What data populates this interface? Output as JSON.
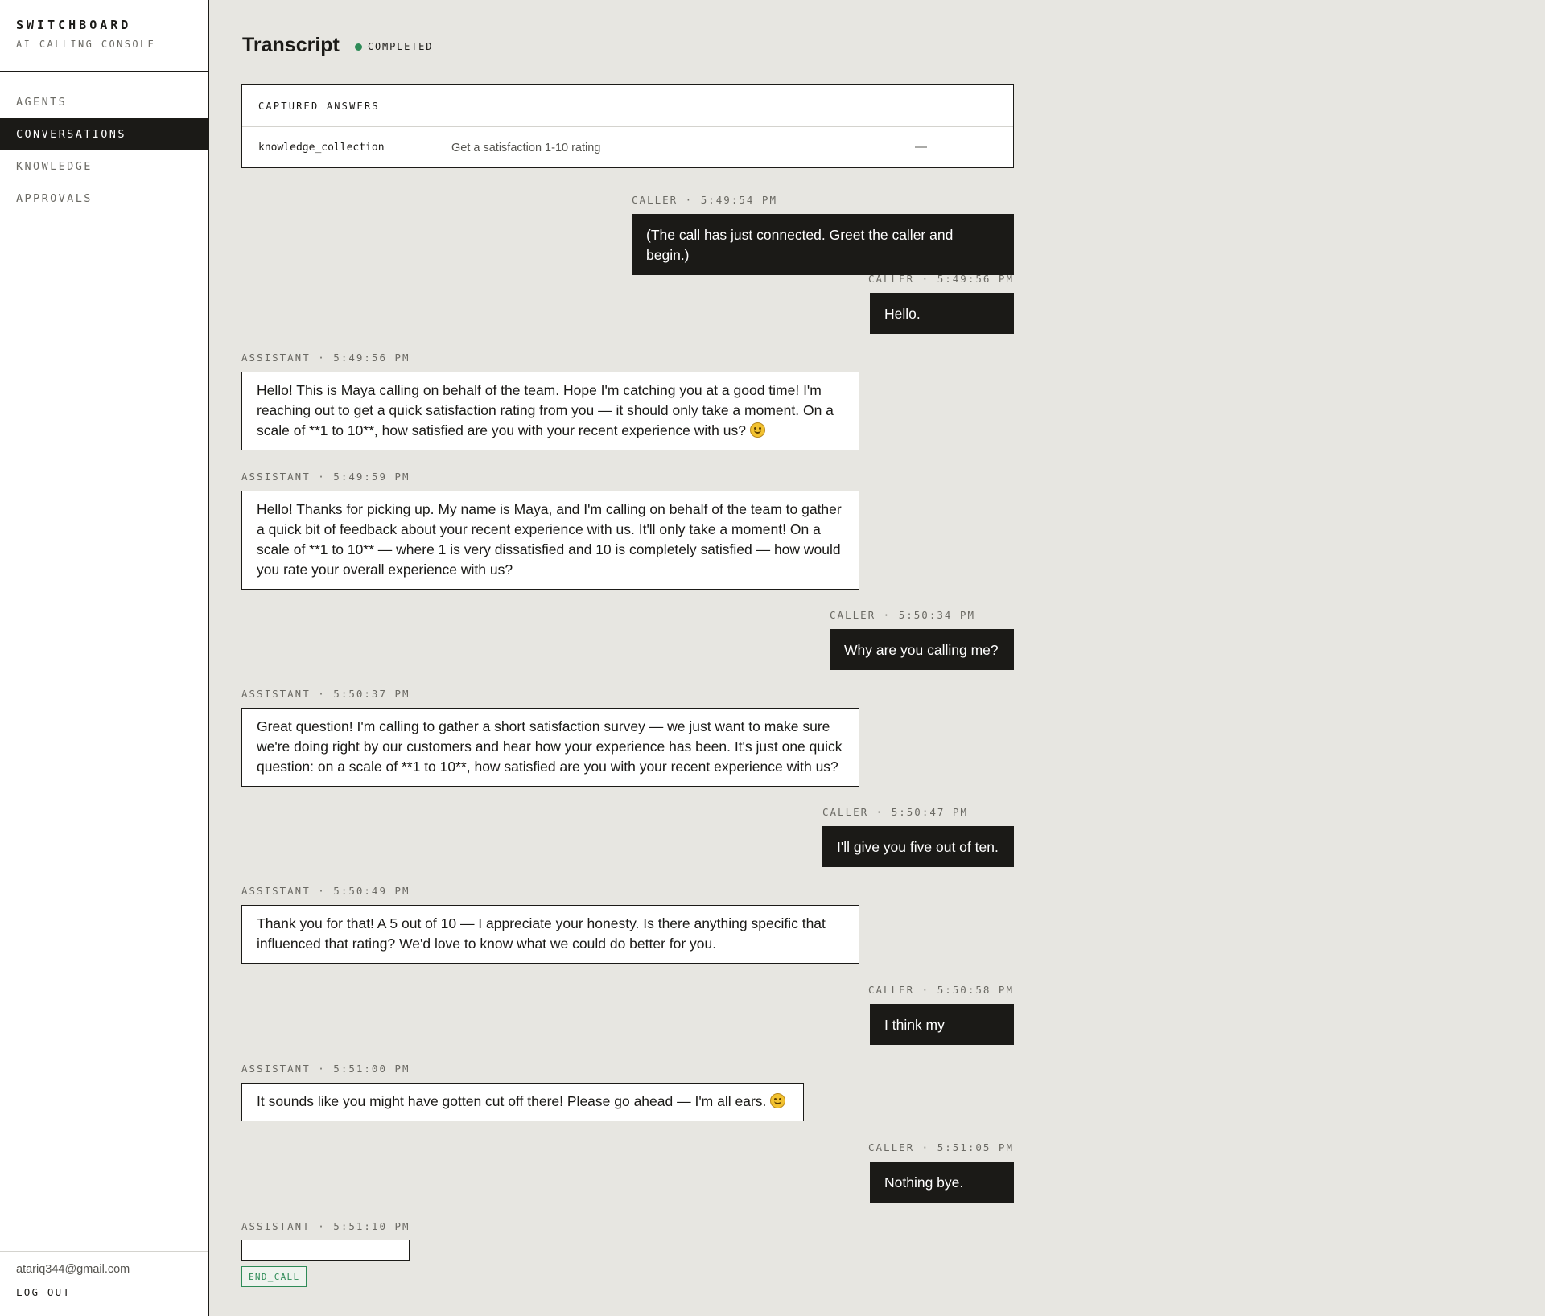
{
  "sidebar": {
    "brand_title": "SWITCHBOARD",
    "brand_subtitle": "AI CALLING CONSOLE",
    "nav": [
      {
        "label": "AGENTS",
        "active": false
      },
      {
        "label": "CONVERSATIONS",
        "active": true
      },
      {
        "label": "KNOWLEDGE",
        "active": false
      },
      {
        "label": "APPROVALS",
        "active": false
      }
    ],
    "user_email": "atariq344@gmail.com",
    "logout_label": "LOG OUT"
  },
  "header": {
    "title": "Transcript",
    "status": "COMPLETED",
    "status_color": "#2e8b57"
  },
  "captured_answers": {
    "heading": "CAPTURED ANSWERS",
    "rows": [
      {
        "key": "knowledge_collection",
        "goal": "Get a satisfaction 1-10 rating",
        "value": "—"
      }
    ]
  },
  "messages": [
    {
      "role": "caller",
      "meta": "CALLER · 5:49:54 PM",
      "text": "(The call has just connected. Greet the caller and begin.)"
    },
    {
      "role": "caller",
      "meta": "CALLER · 5:49:56 PM",
      "text": "Hello."
    },
    {
      "role": "assistant",
      "meta": "ASSISTANT · 5:49:56 PM",
      "text": "Hello! This is Maya calling on behalf of the team. Hope I'm catching you at a good time! I'm reaching out to get a quick satisfaction rating from you — it should only take a moment. On a scale of **1 to 10**, how satisfied are you with your recent experience with us?",
      "emoji": "smiling-face-icon"
    },
    {
      "role": "assistant",
      "meta": "ASSISTANT · 5:49:59 PM",
      "text": "Hello! Thanks for picking up. My name is Maya, and I'm calling on behalf of the team to gather a quick bit of feedback about your recent experience with us. It'll only take a moment! On a scale of **1 to 10** — where 1 is very dissatisfied and 10 is completely satisfied — how would you rate your overall experience with us?"
    },
    {
      "role": "caller",
      "meta": "CALLER · 5:50:34 PM",
      "text": "Why are you calling me?"
    },
    {
      "role": "assistant",
      "meta": "ASSISTANT · 5:50:37 PM",
      "text": "Great question! I'm calling to gather a short satisfaction survey — we just want to make sure we're doing right by our customers and hear how your experience has been. It's just one quick question: on a scale of **1 to 10**, how satisfied are you with your recent experience with us?"
    },
    {
      "role": "caller",
      "meta": "CALLER · 5:50:47 PM",
      "text": "I'll give you five out of ten."
    },
    {
      "role": "assistant",
      "meta": "ASSISTANT · 5:50:49 PM",
      "text": "Thank you for that! A 5 out of 10 — I appreciate your honesty. Is there anything specific that influenced that rating? We'd love to know what we could do better for you."
    },
    {
      "role": "caller",
      "meta": "CALLER · 5:50:58 PM",
      "text": "I think my"
    },
    {
      "role": "assistant",
      "meta": "ASSISTANT · 5:51:00 PM",
      "text": "It sounds like you might have gotten cut off there! Please go ahead — I'm all ears.",
      "emoji": "smiling-face-icon"
    },
    {
      "role": "caller",
      "meta": "CALLER · 5:51:05 PM",
      "text": "Nothing bye."
    },
    {
      "role": "assistant",
      "meta": "ASSISTANT · 5:51:10 PM",
      "text": "",
      "tool_call": "END_CALL"
    }
  ]
}
